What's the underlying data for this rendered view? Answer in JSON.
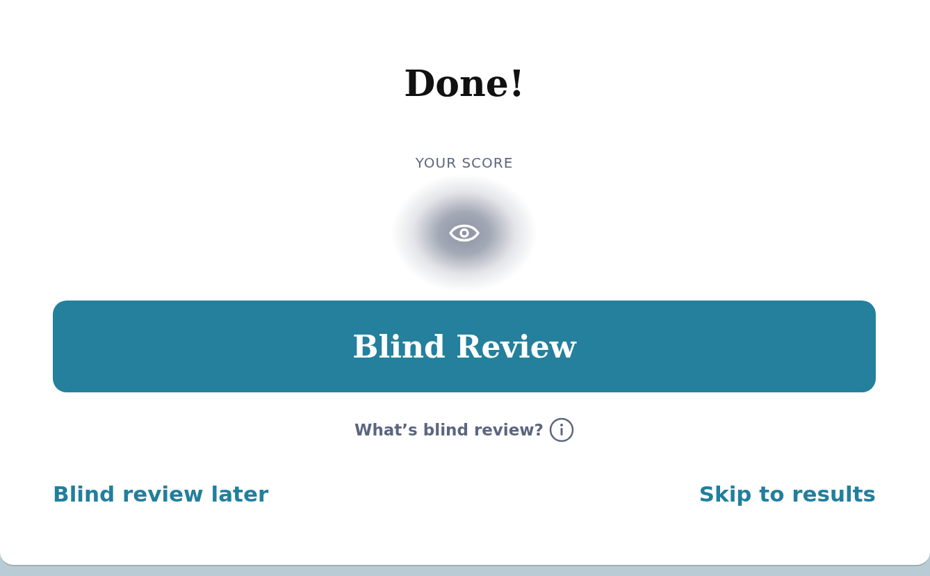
{
  "title": "Done!",
  "score": {
    "label": "YOUR SCORE"
  },
  "primary_button": {
    "label": "Blind Review"
  },
  "help_link": {
    "label": "What’s blind review?"
  },
  "footer_links": [
    {
      "label": "Blind review later"
    },
    {
      "label": "Skip to results"
    }
  ]
}
